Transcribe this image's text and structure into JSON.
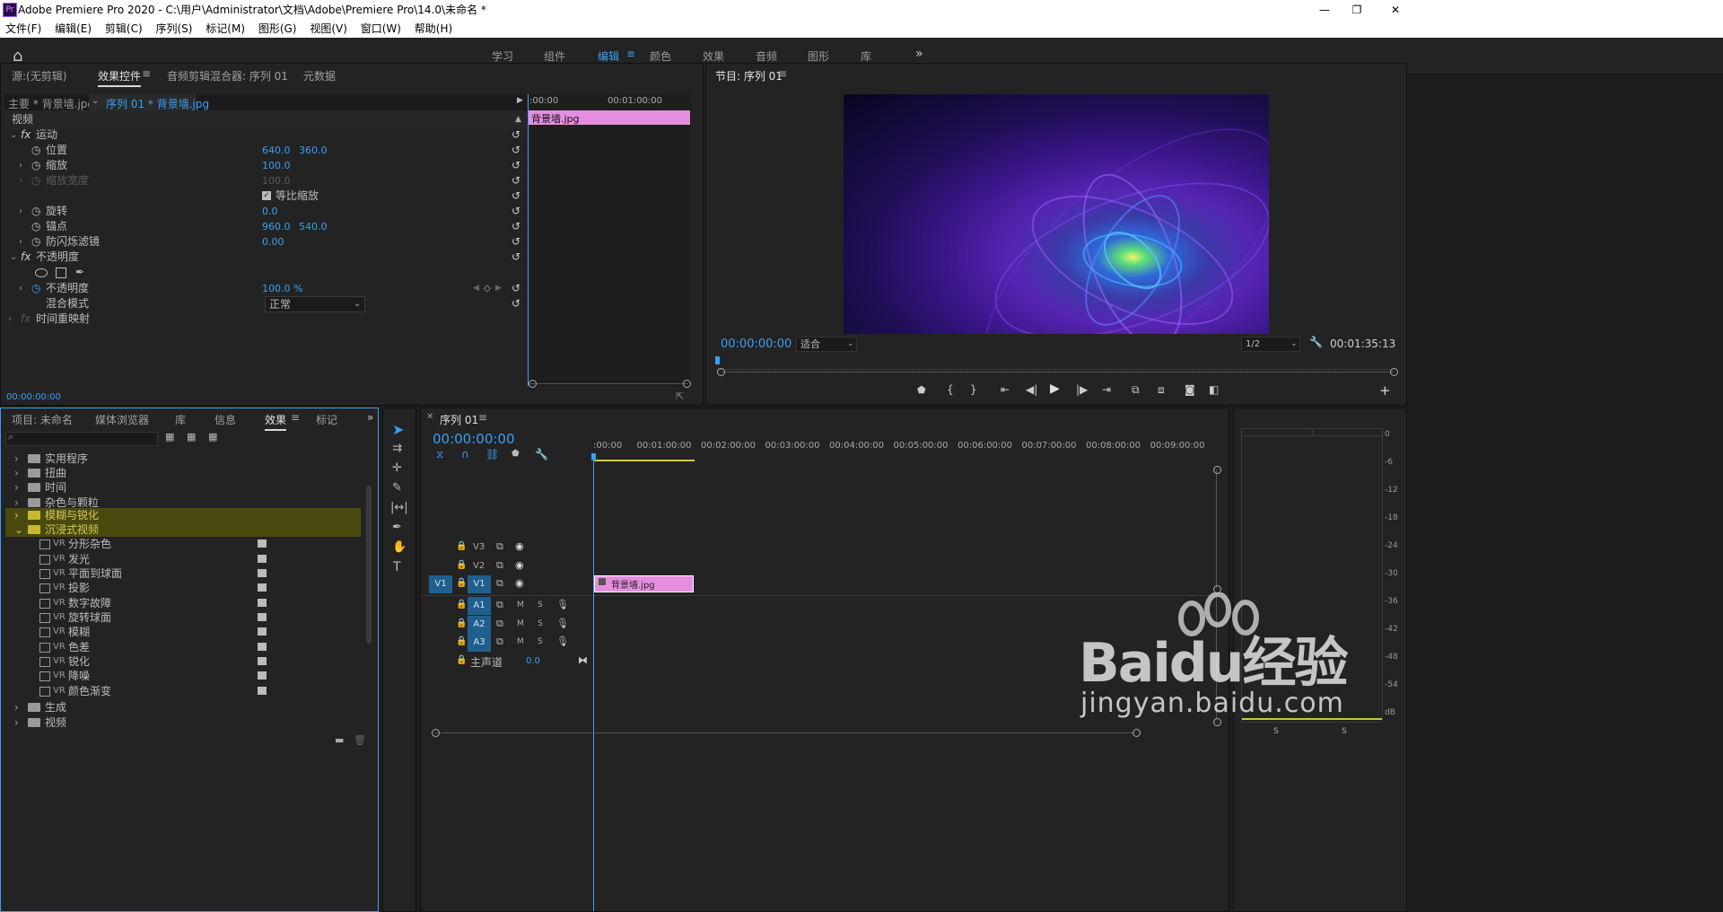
{
  "titlebar": {
    "title": "Adobe Premiere Pro 2020 - C:\\用户\\Administrator\\文档\\Adobe\\Premiere Pro\\14.0\\未命名 *",
    "app_icon": "Pr"
  },
  "menu": [
    "文件(F)",
    "编辑(E)",
    "剪辑(C)",
    "序列(S)",
    "标记(M)",
    "图形(G)",
    "视图(V)",
    "窗口(W)",
    "帮助(H)"
  ],
  "workspaces": {
    "items": [
      "学习",
      "组件",
      "编辑",
      "颜色",
      "效果",
      "音频",
      "图形",
      "库"
    ],
    "active": "编辑",
    "more": "»"
  },
  "source_panel": {
    "tabs": [
      "源:(无剪辑)",
      "效果控件",
      "音频剪辑混合器: 序列 01",
      "元数据"
    ],
    "active_tab": "效果控件",
    "clip_master": "主要 * 背景墙.jpg",
    "clip_seq": "序列 01 * 背景墙.jpg",
    "mini_ruler": [
      ":00:00",
      "00:01:00:00"
    ],
    "clip_name": "背景墙.jpg",
    "section_video": "视频",
    "motion": "运动",
    "position_label": "位置",
    "position_x": "640.0",
    "position_y": "360.0",
    "scale_label": "缩放",
    "scale_val": "100.0",
    "scale_width_label": "缩放宽度",
    "scale_width_val": "100.0",
    "uniform_label": "等比缩放",
    "rotation_label": "旋转",
    "rotation_val": "0.0",
    "anchor_label": "锚点",
    "anchor_x": "960.0",
    "anchor_y": "540.0",
    "antiflicker_label": "防闪烁滤镜",
    "antiflicker_val": "0.00",
    "opacity_section": "不透明度",
    "opacity_label": "不透明度",
    "opacity_val": "100.0 %",
    "blend_label": "混合模式",
    "blend_val": "正常",
    "timeremap_label": "时间重映射",
    "timecode": "00:00:00:00"
  },
  "program_panel": {
    "title": "节目: 序列 01",
    "timecode": "00:00:00:00",
    "fit": "适合",
    "resolution": "1/2",
    "duration": "00:01:35:13"
  },
  "project_panel": {
    "tabs": [
      "项目: 未命名",
      "媒体浏览器",
      "库",
      "信息",
      "效果",
      "标记"
    ],
    "active_tab": "效果",
    "folders_top": [
      "实用程序",
      "扭曲",
      "时间",
      "杂色与颗粒",
      "模糊与锐化",
      "沉浸式视频"
    ],
    "vr_effects": [
      "分形杂色",
      "发光",
      "平面到球面",
      "投影",
      "数字故障",
      "旋转球面",
      "模糊",
      "色差",
      "锐化",
      "降噪",
      "颜色渐变"
    ],
    "vr_prefix": "VR",
    "folders_bottom": [
      "生成",
      "视频"
    ]
  },
  "timeline": {
    "title": "序列 01",
    "timecode": "00:00:00:00",
    "ruler": [
      ":00:00",
      "00:01:00:00",
      "00:02:00:00",
      "00:03:00:00",
      "00:04:00:00",
      "00:05:00:00",
      "00:06:00:00",
      "00:07:00:00",
      "00:08:00:00",
      "00:09:00:00"
    ],
    "video_tracks": [
      "V3",
      "V2",
      "V1"
    ],
    "audio_tracks": [
      "A1",
      "A2",
      "A3"
    ],
    "source_patch": "V1",
    "m": "M",
    "s": "S",
    "master_label": "主声道",
    "master_val": "0.0",
    "clip_name": "背景墙.jpg"
  },
  "meter": {
    "scale": [
      "0",
      "-6",
      "-12",
      "-18",
      "-24",
      "-30",
      "-36",
      "-42",
      "-48",
      "-54",
      "dB"
    ],
    "solo": [
      "S",
      "S"
    ]
  },
  "watermark": {
    "line1": "Baidu经验",
    "line2": "jingyan.baidu.com"
  },
  "colors": {
    "accent": "#3a9ff5",
    "clip_pink": "#e58ee0",
    "folder_yellow": "#4a4a10",
    "track_blue": "#1f5f8e"
  }
}
